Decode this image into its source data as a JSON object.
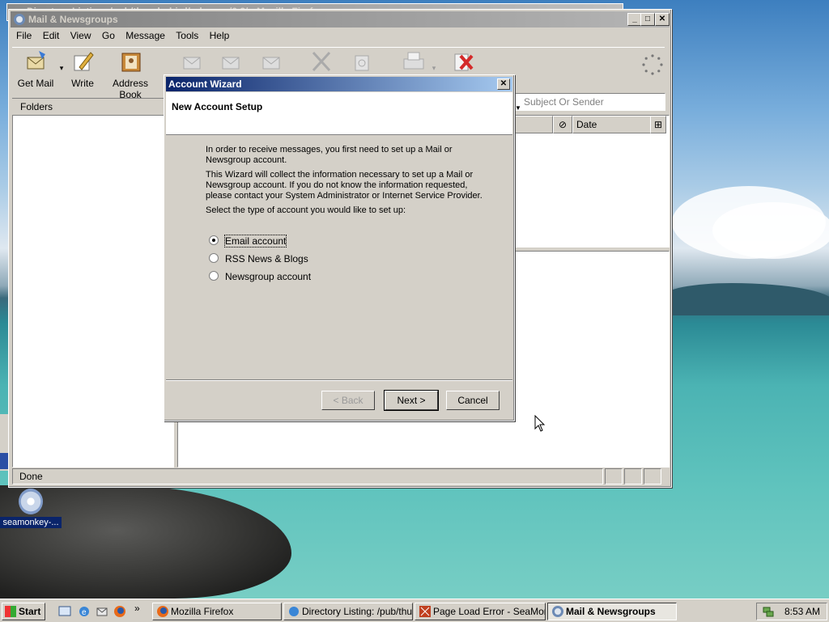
{
  "background_window": {
    "title": "Directory Listing: /pub/thunderbird/releases/0.2/ - Mozilla Firefox"
  },
  "main_window": {
    "title": "Mail & Newsgroups",
    "menu": [
      "File",
      "Edit",
      "View",
      "Go",
      "Message",
      "Tools",
      "Help"
    ],
    "toolbar": {
      "get_mail": "Get Mail",
      "write": "Write",
      "address_book": "Address Book"
    },
    "folders_label": "Folders",
    "search_placeholder": "Subject Or Sender",
    "columns": {
      "date": "Date"
    },
    "status": "Done"
  },
  "wizard": {
    "title": "Account Wizard",
    "header": "New Account Setup",
    "para1": "In order to receive messages, you first need to set up a Mail or Newsgroup account.",
    "para2": "This Wizard will collect the information necessary to set up a Mail or Newsgroup account. If you do not know the information requested, please contact your System Administrator or Internet Service Provider.",
    "para3": "Select the type of account you would like to set up:",
    "options": [
      "Email account",
      "RSS News & Blogs",
      "Newsgroup account"
    ],
    "selected_option": "Email account",
    "buttons": {
      "back": "< Back",
      "next": "Next >",
      "cancel": "Cancel"
    }
  },
  "desktop_icon": {
    "label": "seamonkey-..."
  },
  "taskbar": {
    "start": "Start",
    "tasks": [
      "Mozilla Firefox",
      "Directory Listing: /pub/thu...",
      "Page Load Error - SeaMon...",
      "Mail & Newsgroups"
    ],
    "active_task": "Mail & Newsgroups",
    "clock": "8:53 AM"
  }
}
